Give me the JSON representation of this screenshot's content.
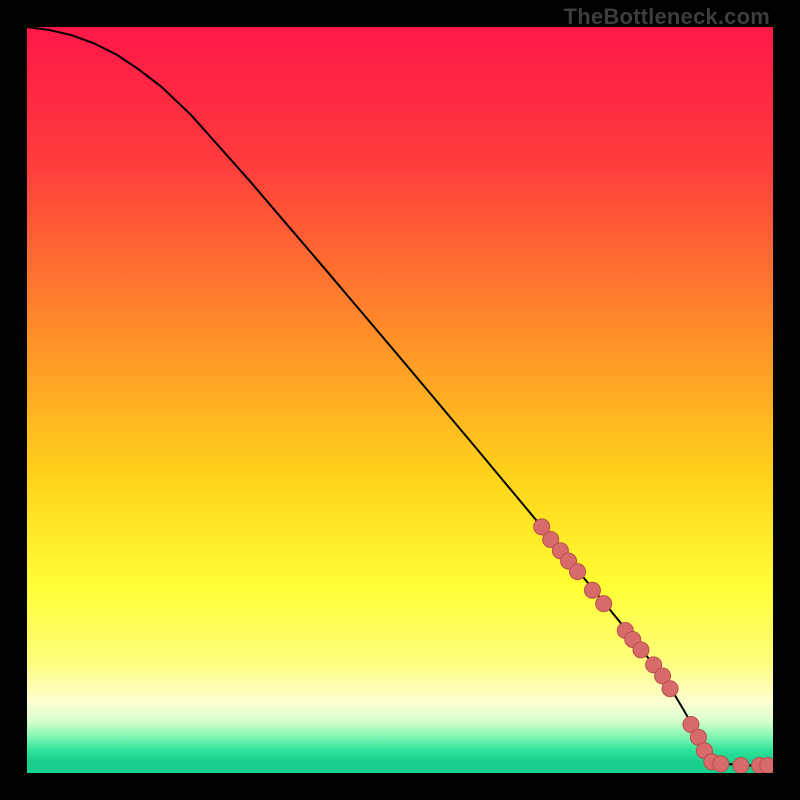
{
  "watermark": "TheBottleneck.com",
  "colors": {
    "frame": "#000000",
    "curve": "#000000",
    "marker_fill": "#d96a6a",
    "marker_stroke": "#b84f4f",
    "gradient_stops": [
      {
        "offset": 0.0,
        "color": "#ff1748"
      },
      {
        "offset": 0.18,
        "color": "#ff3b3d"
      },
      {
        "offset": 0.4,
        "color": "#ff8a2a"
      },
      {
        "offset": 0.6,
        "color": "#ffd21a"
      },
      {
        "offset": 0.75,
        "color": "#ffff33"
      },
      {
        "offset": 0.85,
        "color": "#ffff7d"
      },
      {
        "offset": 0.905,
        "color": "#fdffd0"
      },
      {
        "offset": 0.93,
        "color": "#d9ffcf"
      },
      {
        "offset": 0.95,
        "color": "#85f7b3"
      },
      {
        "offset": 0.97,
        "color": "#2fe39a"
      },
      {
        "offset": 0.985,
        "color": "#18cf8b"
      },
      {
        "offset": 1.0,
        "color": "#17d18e"
      }
    ]
  },
  "chart_data": {
    "type": "line",
    "title": "",
    "xlabel": "",
    "ylabel": "",
    "xlim": [
      0,
      100
    ],
    "ylim": [
      0,
      100
    ],
    "series": [
      {
        "name": "curve",
        "x": [
          0,
          3,
          6,
          9,
          12,
          15,
          18,
          22,
          30,
          40,
          50,
          60,
          70,
          76,
          80,
          84,
          86.5,
          88,
          90,
          92,
          94,
          96,
          98,
          100
        ],
        "y": [
          100,
          99.6,
          98.9,
          97.8,
          96.3,
          94.3,
          92.0,
          88.2,
          79.2,
          67.5,
          55.7,
          43.8,
          31.8,
          24.5,
          19.6,
          14.5,
          11.0,
          8.5,
          5.0,
          2.4,
          1.2,
          1.0,
          1.0,
          1.0
        ]
      }
    ],
    "markers": [
      {
        "x": 69.0,
        "y": 33.0
      },
      {
        "x": 70.2,
        "y": 31.3
      },
      {
        "x": 71.5,
        "y": 29.8
      },
      {
        "x": 72.6,
        "y": 28.4
      },
      {
        "x": 73.8,
        "y": 27.0
      },
      {
        "x": 75.8,
        "y": 24.5
      },
      {
        "x": 77.3,
        "y": 22.7
      },
      {
        "x": 80.2,
        "y": 19.1
      },
      {
        "x": 81.2,
        "y": 17.9
      },
      {
        "x": 82.3,
        "y": 16.5
      },
      {
        "x": 84.0,
        "y": 14.5
      },
      {
        "x": 85.2,
        "y": 13.0
      },
      {
        "x": 86.2,
        "y": 11.3
      },
      {
        "x": 89.0,
        "y": 6.5
      },
      {
        "x": 90.0,
        "y": 4.8
      },
      {
        "x": 90.8,
        "y": 3.0
      },
      {
        "x": 91.8,
        "y": 1.5
      },
      {
        "x": 93.0,
        "y": 1.2
      },
      {
        "x": 95.7,
        "y": 1.0
      },
      {
        "x": 98.2,
        "y": 1.0
      },
      {
        "x": 99.3,
        "y": 1.0
      }
    ],
    "marker_radius_px": 8
  }
}
